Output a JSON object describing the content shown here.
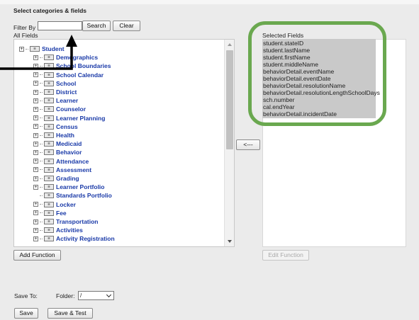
{
  "header": {
    "title": "Select categories & fields"
  },
  "filter": {
    "label": "Filter By",
    "value": "",
    "search_label": "Search",
    "clear_label": "Clear"
  },
  "all_fields": {
    "label": "All Fields",
    "items": [
      {
        "label": "Student",
        "expandable": true,
        "indent": 0
      },
      {
        "label": "Demographics",
        "expandable": true,
        "indent": 1
      },
      {
        "label": "School Boundaries",
        "expandable": true,
        "indent": 1
      },
      {
        "label": "School Calendar",
        "expandable": true,
        "indent": 1
      },
      {
        "label": "School",
        "expandable": true,
        "indent": 1
      },
      {
        "label": "District",
        "expandable": true,
        "indent": 1
      },
      {
        "label": "Learner",
        "expandable": true,
        "indent": 1
      },
      {
        "label": "Counselor",
        "expandable": true,
        "indent": 1
      },
      {
        "label": "Learner Planning",
        "expandable": true,
        "indent": 1
      },
      {
        "label": "Census",
        "expandable": true,
        "indent": 1
      },
      {
        "label": "Health",
        "expandable": true,
        "indent": 1
      },
      {
        "label": "Medicaid",
        "expandable": true,
        "indent": 1
      },
      {
        "label": "Behavior",
        "expandable": true,
        "indent": 1
      },
      {
        "label": "Attendance",
        "expandable": true,
        "indent": 1
      },
      {
        "label": "Assessment",
        "expandable": true,
        "indent": 1
      },
      {
        "label": "Grading",
        "expandable": true,
        "indent": 1
      },
      {
        "label": "Learner Portfolio",
        "expandable": true,
        "indent": 1
      },
      {
        "label": "Standards Portfolio",
        "expandable": false,
        "indent": 1
      },
      {
        "label": "Locker",
        "expandable": true,
        "indent": 1
      },
      {
        "label": "Fee",
        "expandable": true,
        "indent": 1
      },
      {
        "label": "Transportation",
        "expandable": true,
        "indent": 1
      },
      {
        "label": "Activities",
        "expandable": true,
        "indent": 1
      },
      {
        "label": "Activity Registration",
        "expandable": true,
        "indent": 1
      }
    ]
  },
  "selected_fields": {
    "label": "Selected Fields",
    "items": [
      "student.stateID",
      "student.lastName",
      "student.firstName",
      "student.middleName",
      "behaviorDetail.eventName",
      "behaviorDetail.eventDate",
      "behaviorDetail.resolutionName",
      "behaviorDetail.resolutionLengthSchoolDays",
      "sch.number",
      "cal.endYear",
      "behaviorDetail.incidentDate"
    ]
  },
  "buttons": {
    "remove_label": "<---",
    "add_function_label": "Add Function",
    "edit_function_label": "Edit Function",
    "save_label": "Save",
    "save_test_label": "Save & Test"
  },
  "save_to": {
    "label": "Save To:",
    "folder_label": "Folder:",
    "folder_value": "/"
  },
  "icons": {
    "expander": "plus-expander-icon",
    "node": "database-table-icon",
    "tree_node_text": "≡"
  },
  "colors": {
    "tree_label": "#1a3aa8",
    "highlight_ring": "#6aa84f",
    "selected_bg": "#c9c9c9",
    "page_bg": "#ebebeb"
  }
}
